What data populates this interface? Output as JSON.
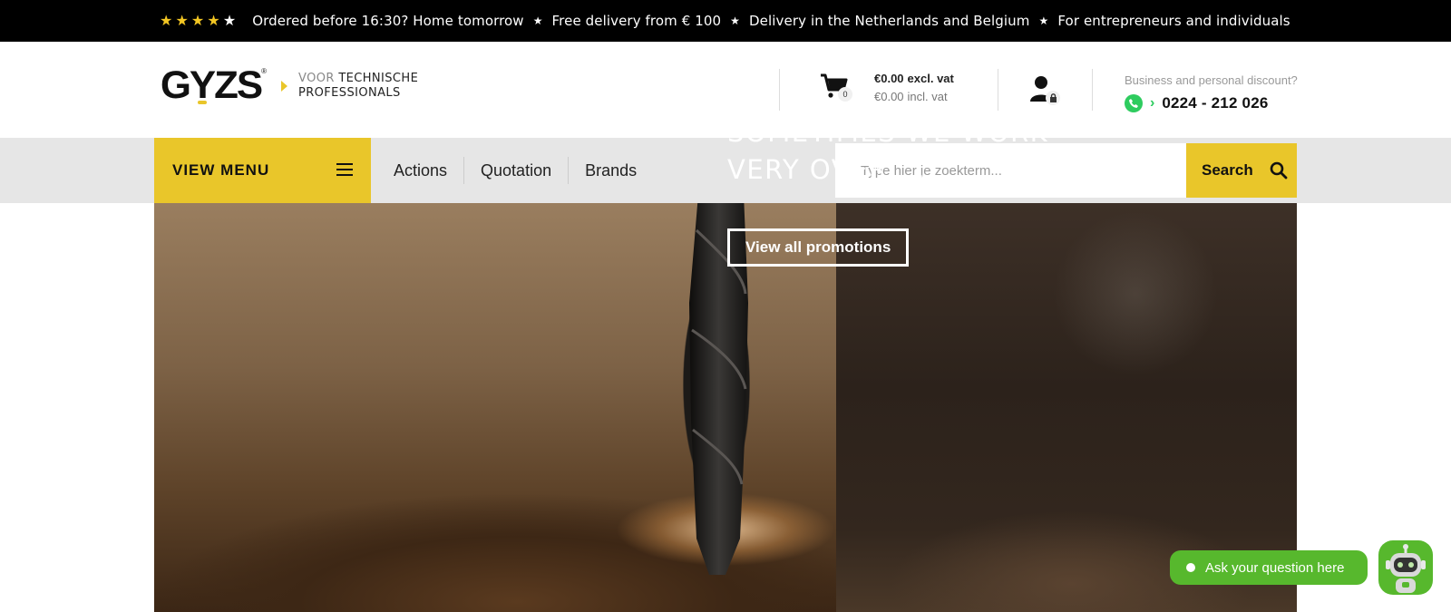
{
  "topbar": {
    "rating_stars_filled": 4,
    "rating_stars_total": 5,
    "star_color": "#f3c623",
    "usps": [
      "Ordered before 16:30? Home tomorrow",
      "Free delivery from € 100",
      "Delivery in the Netherlands and Belgium",
      "For entrepreneurs and individuals"
    ],
    "separator_icon": "star-icon"
  },
  "header": {
    "logo_text": "GYZS",
    "logo_reg": "®",
    "tagline_line1_muted": "VOOR",
    "tagline_line1": "TECHNISCHE",
    "tagline_line2": "PROFESSIONALS",
    "cart": {
      "icon": "cart-icon",
      "count": "0",
      "price_excl": "€0.00",
      "price_excl_label": "excl. vat",
      "price_incl": "€0.00",
      "price_incl_label": "incl. vat"
    },
    "account": {
      "icon": "user-icon",
      "badge_icon": "lock-icon"
    },
    "discount_text": "Business and personal discount?",
    "phone": "0224 - 212 026",
    "whatsapp_icon": "whatsapp-icon"
  },
  "nav": {
    "menu_label": "VIEW MENU",
    "links": [
      "Actions",
      "Quotation",
      "Brands"
    ],
    "search_placeholder": "Type hier je zoekterm...",
    "search_label": "Search"
  },
  "hero": {
    "title": "SOMETIMES WE WORK VERY OVER....",
    "cta": "View all promotions"
  },
  "chat": {
    "label": "Ask your question here",
    "bot_icon": "robot-icon"
  },
  "colors": {
    "accent_yellow": "#e9c62a",
    "chat_green": "#57b82d",
    "whatsapp_green": "#2ecc5f",
    "topbar_bg": "#000000"
  }
}
